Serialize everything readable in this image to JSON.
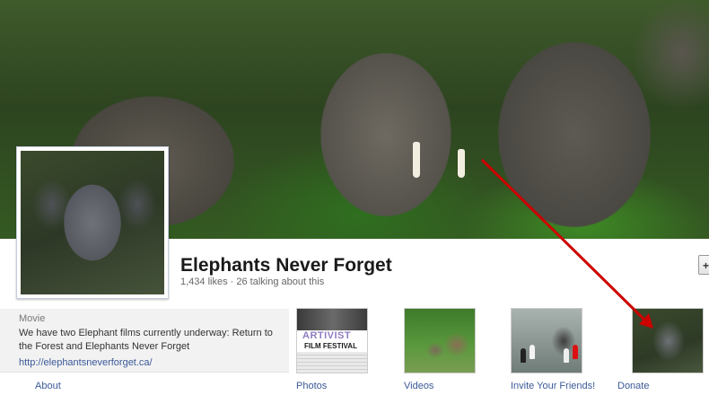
{
  "page": {
    "title": "Elephants Never Forget",
    "stats": "1,434 likes · 26 talking about this",
    "like_button": "+"
  },
  "about": {
    "heading": "Movie",
    "description": "We have two Elephant films currently underway: Return to the Forest and Elephants Never Forget",
    "link": "http://elephantsneverforget.ca/",
    "tab_label": "About"
  },
  "tabs": [
    {
      "label": "Photos",
      "poster_title": "ARTIVIST",
      "poster_subtitle": "FILM FESTIVAL"
    },
    {
      "label": "Videos"
    },
    {
      "label": "Invite Your Friends!"
    },
    {
      "label": "Donate"
    }
  ],
  "colors": {
    "link": "#3b5998",
    "annotation_arrow": "#cc0000"
  }
}
